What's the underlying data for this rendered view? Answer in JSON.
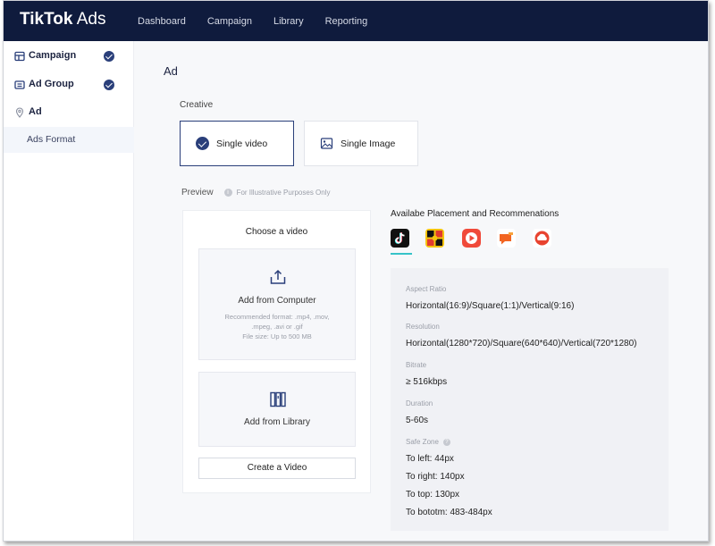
{
  "logo": {
    "brand": "TikTok",
    "suffix": "Ads"
  },
  "topnav": [
    "Dashboard",
    "Campaign",
    "Library",
    "Reporting"
  ],
  "sidebar": {
    "items": [
      {
        "label": "Campaign",
        "icon": "campaign-icon",
        "done": true
      },
      {
        "label": "Ad Group",
        "icon": "ad-group-icon",
        "done": true
      },
      {
        "label": "Ad",
        "icon": "location-pin-icon",
        "done": false
      }
    ],
    "sub_item": "Ads Format"
  },
  "main": {
    "title": "Ad",
    "creative_label": "Creative",
    "options": [
      {
        "label": "Single video",
        "icon": "check-circle-icon",
        "selected": true
      },
      {
        "label": "Single Image",
        "icon": "image-icon",
        "selected": false
      }
    ],
    "preview_label": "Preview",
    "preview_note": "For Illustrative Purposes Only",
    "choose": {
      "title": "Choose a video",
      "computer": {
        "title": "Add from Computer",
        "note_line1": "Recommended format: .mp4, .mov,",
        "note_line2": ".mpeg, .avi or .gif",
        "note_line3": "File size: Up to 500 MB"
      },
      "library": {
        "title": "Add from Library"
      },
      "create_button": "Create a Video"
    },
    "placement": {
      "title": "Availabe Placement and Recommenations",
      "apps": [
        "tiktok-icon",
        "buzzvideo-icon",
        "topbuzz-icon",
        "babe-icon",
        "pangle-icon"
      ]
    },
    "specs": {
      "aspect_label": "Aspect Ratio",
      "aspect_value": "Horizontal(16:9)/Square(1:1)/Vertical(9:16)",
      "resolution_label": "Resolution",
      "resolution_value": "Horizontal(1280*720)/Square(640*640)/Vertical(720*1280)",
      "bitrate_label": "Bitrate",
      "bitrate_value": "≥ 516kbps",
      "duration_label": "Duration",
      "duration_value": "5-60s",
      "safe_label": "Safe Zone",
      "safe_left": "To left: 44px",
      "safe_right": "To right: 140px",
      "safe_top": "To top: 130px",
      "safe_bottom": "To bototm: 483-484px"
    }
  },
  "colors": {
    "topbar": "#0f1b3d",
    "accent": "#2a3f7a",
    "underline": "#36c3c8"
  }
}
